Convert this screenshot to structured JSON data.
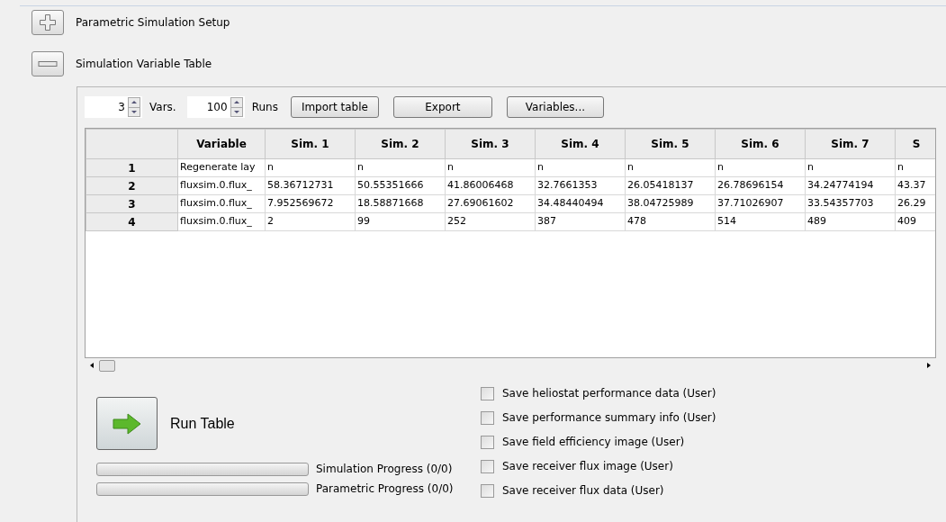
{
  "sections": [
    {
      "title": "Parametric Simulation Setup",
      "expanded": false
    },
    {
      "title": "Simulation Variable Table",
      "expanded": true
    }
  ],
  "toolbar": {
    "vars_value": "3",
    "vars_label": "Vars.",
    "runs_value": "100",
    "runs_label": "Runs",
    "buttons": [
      "Import table",
      "Export",
      "Variables..."
    ]
  },
  "table": {
    "columns": [
      "Variable",
      "Sim. 1",
      "Sim. 2",
      "Sim. 3",
      "Sim. 4",
      "Sim. 5",
      "Sim. 6",
      "Sim. 7",
      "S"
    ],
    "rows": [
      {
        "header": "1",
        "cells": [
          "Regenerate lay",
          "n",
          "n",
          "n",
          "n",
          "n",
          "n",
          "n",
          "n"
        ]
      },
      {
        "header": "2",
        "cells": [
          "fluxsim.0.flux_",
          "58.36712731",
          "50.55351666",
          "41.86006468",
          "32.7661353",
          "26.05418137",
          "26.78696154",
          "34.24774194",
          "43.37"
        ]
      },
      {
        "header": "3",
        "cells": [
          "fluxsim.0.flux_",
          "7.952569672",
          "18.58871668",
          "27.69061602",
          "34.48440494",
          "38.04725989",
          "37.71026907",
          "33.54357703",
          "26.29"
        ]
      },
      {
        "header": "4",
        "cells": [
          "fluxsim.0.flux_",
          "2",
          "99",
          "252",
          "387",
          "478",
          "514",
          "489",
          "409"
        ]
      }
    ]
  },
  "run_button": {
    "label": "Run Table"
  },
  "progress": [
    {
      "label": "Simulation Progress (0/0)",
      "level": 0
    },
    {
      "label": "Parametric Progress (0/0)",
      "level": 0
    }
  ],
  "options": [
    {
      "label": "Save heliostat performance data (User)",
      "checked": false
    },
    {
      "label": "Save performance summary info (User)",
      "checked": false
    },
    {
      "label": "Save field efficiency image (User)",
      "checked": false
    },
    {
      "label": "Save receiver flux image (User)",
      "checked": false
    },
    {
      "label": "Save receiver flux data (User)",
      "checked": false
    }
  ]
}
